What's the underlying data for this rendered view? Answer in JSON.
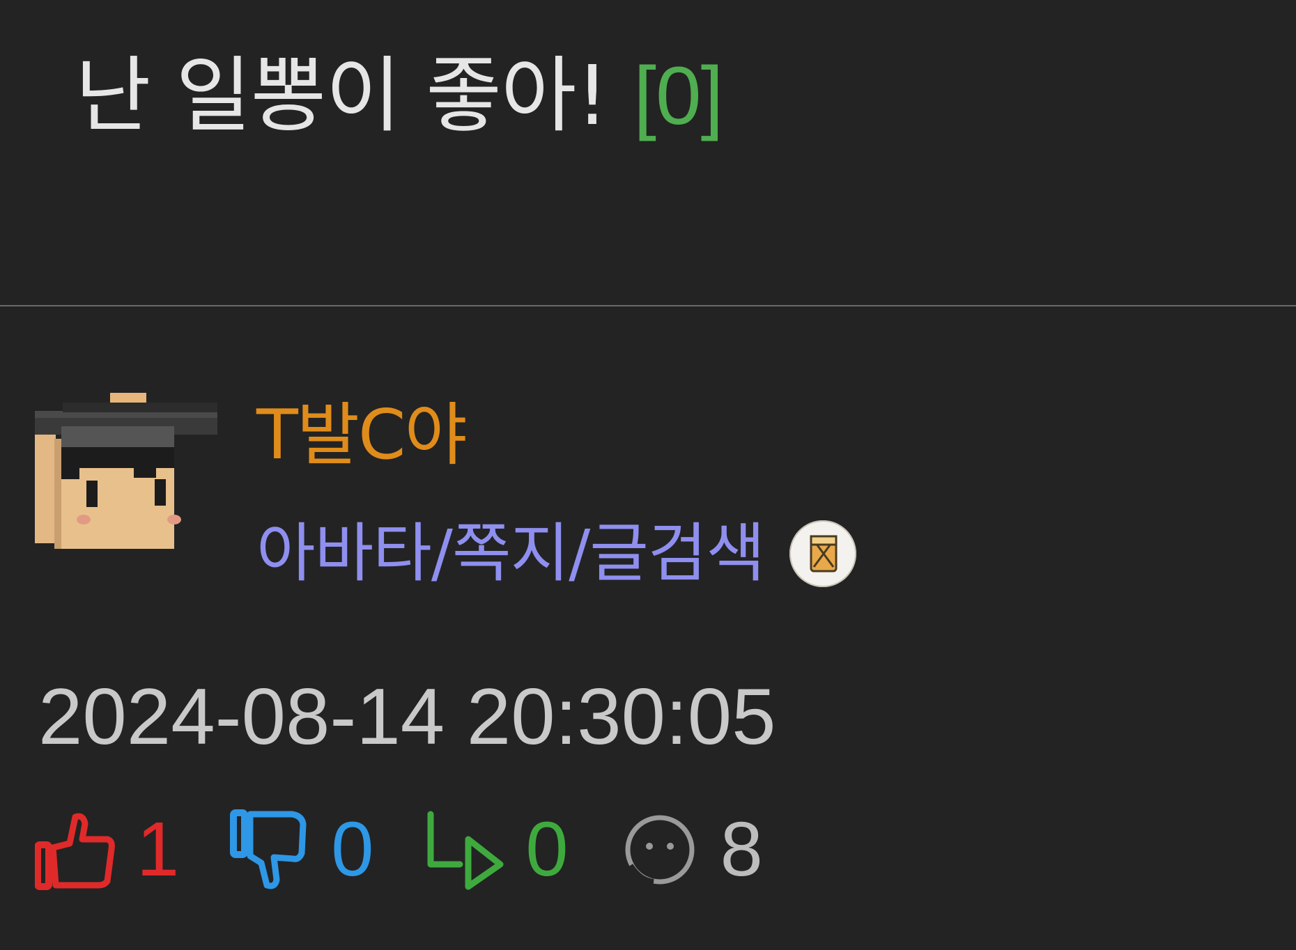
{
  "post": {
    "title": "난 일뽕이 좋아! ",
    "comment_count": "[0]"
  },
  "author": {
    "name": "T발C야",
    "links": "아바타/쪽지/글검색",
    "badge_icon": "badge-icon"
  },
  "date": "2024-08-14 20:30:05",
  "stats": {
    "upvotes": "1",
    "downvotes": "0",
    "shares": "0",
    "views": "8"
  },
  "colors": {
    "background": "#232323",
    "title": "#e6e6e6",
    "comment_count": "#4fae4f",
    "author_name": "#e08c1b",
    "author_links": "#8f8ff0",
    "upvote": "#e02a2a",
    "downvote": "#2e97e6",
    "share": "#3eaa3e",
    "view": "#bdbdbd"
  }
}
